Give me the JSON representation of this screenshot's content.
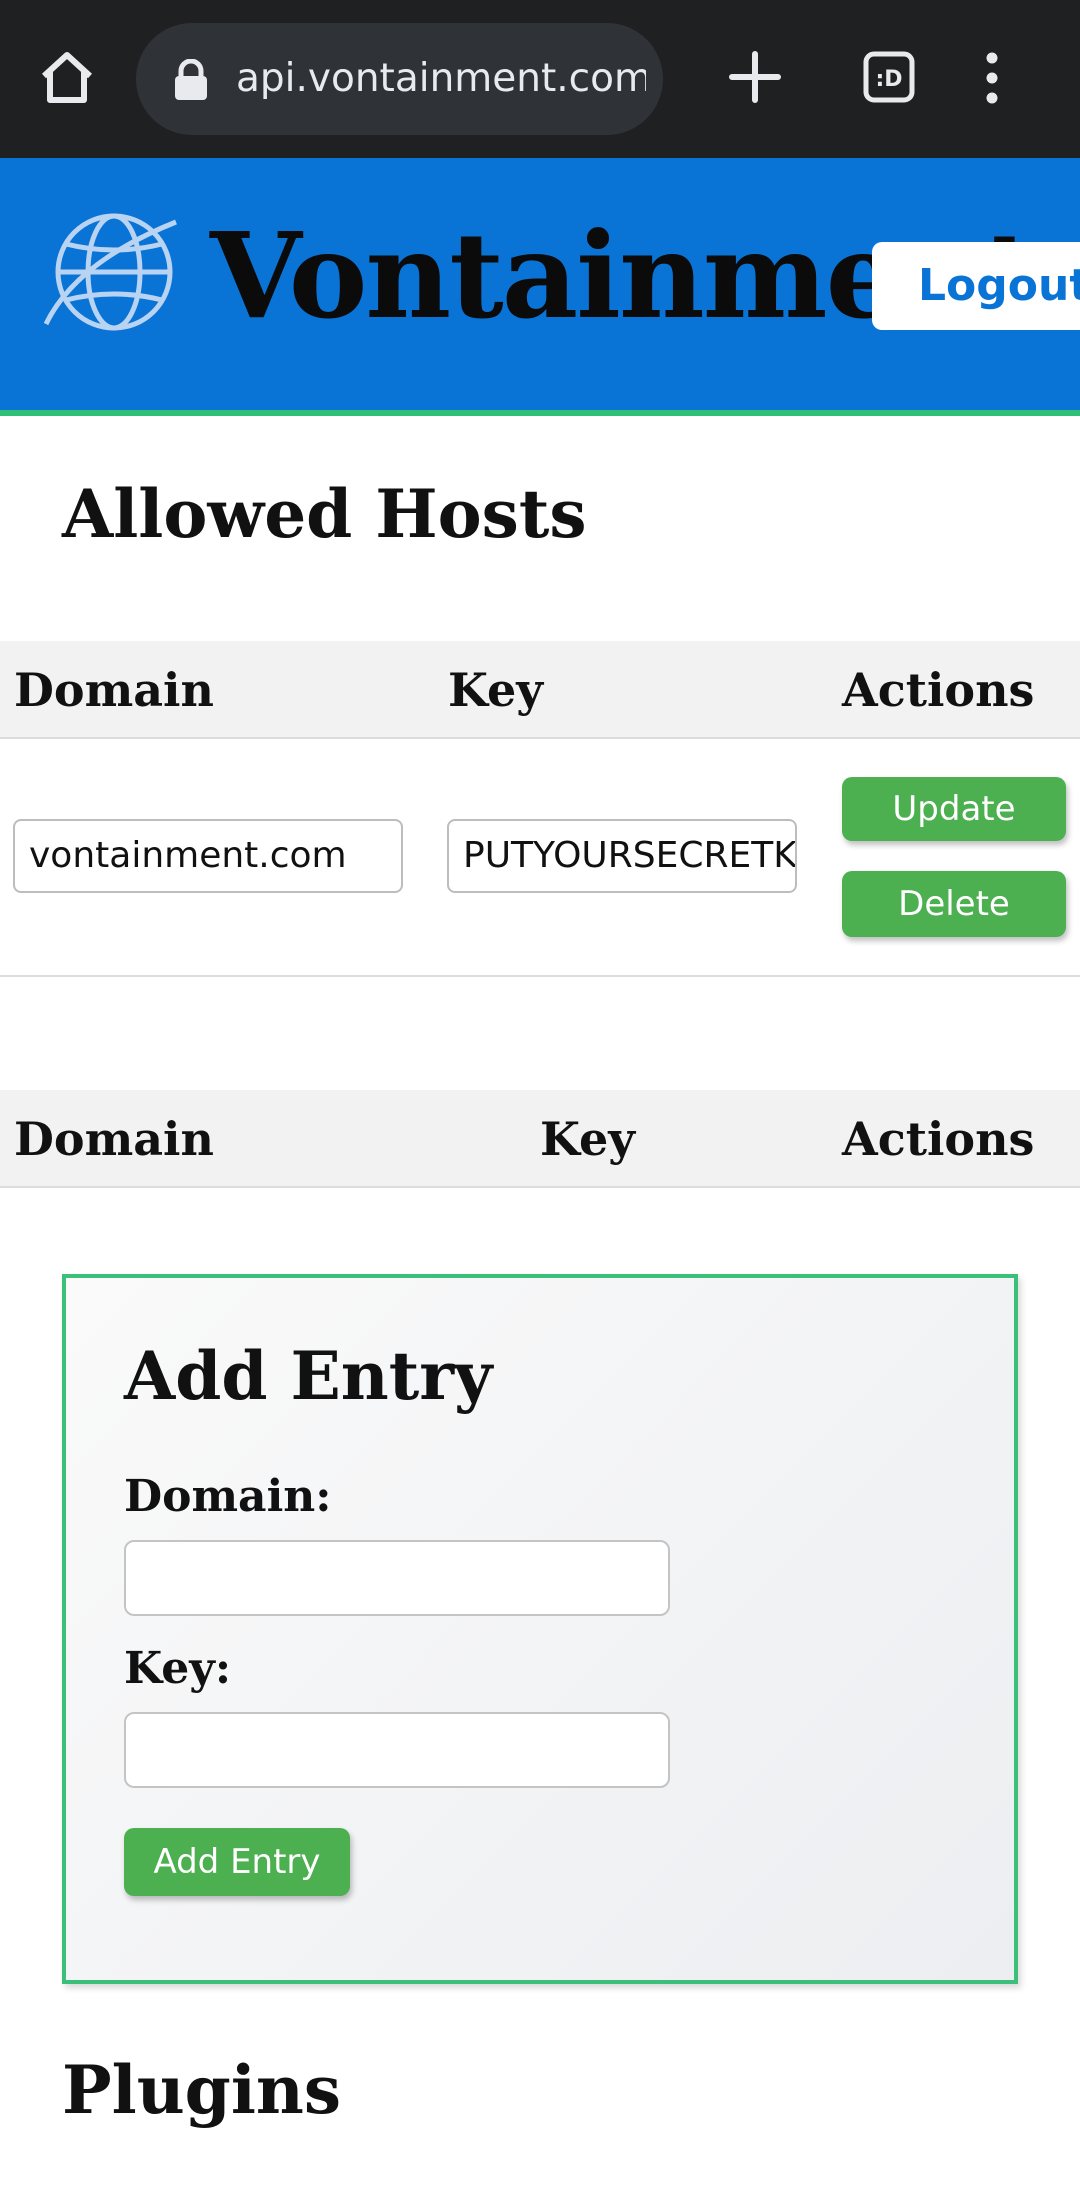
{
  "browser": {
    "url": "api.vontainment.com/",
    "tab_count": ":D"
  },
  "header": {
    "brand": "Vontainment",
    "logout_label": "Logout"
  },
  "allowed_hosts": {
    "title": "Allowed Hosts",
    "columns": [
      "Domain",
      "Key",
      "Actions"
    ],
    "rows": [
      {
        "domain": "vontainment.com",
        "key": "PUTYOURSECRETKEY",
        "update_label": "Update",
        "delete_label": "Delete"
      }
    ]
  },
  "second_table": {
    "columns": [
      "Domain",
      "Key",
      "Actions"
    ]
  },
  "add_entry": {
    "title": "Add Entry",
    "domain_label": "Domain:",
    "domain_value": "",
    "key_label": "Key:",
    "key_value": "",
    "submit_label": "Add Entry"
  },
  "plugins": {
    "title": "Plugins"
  },
  "colors": {
    "header_blue": "#0a73d6",
    "accent_green": "#4caf50",
    "card_border": "#3cbf78"
  }
}
